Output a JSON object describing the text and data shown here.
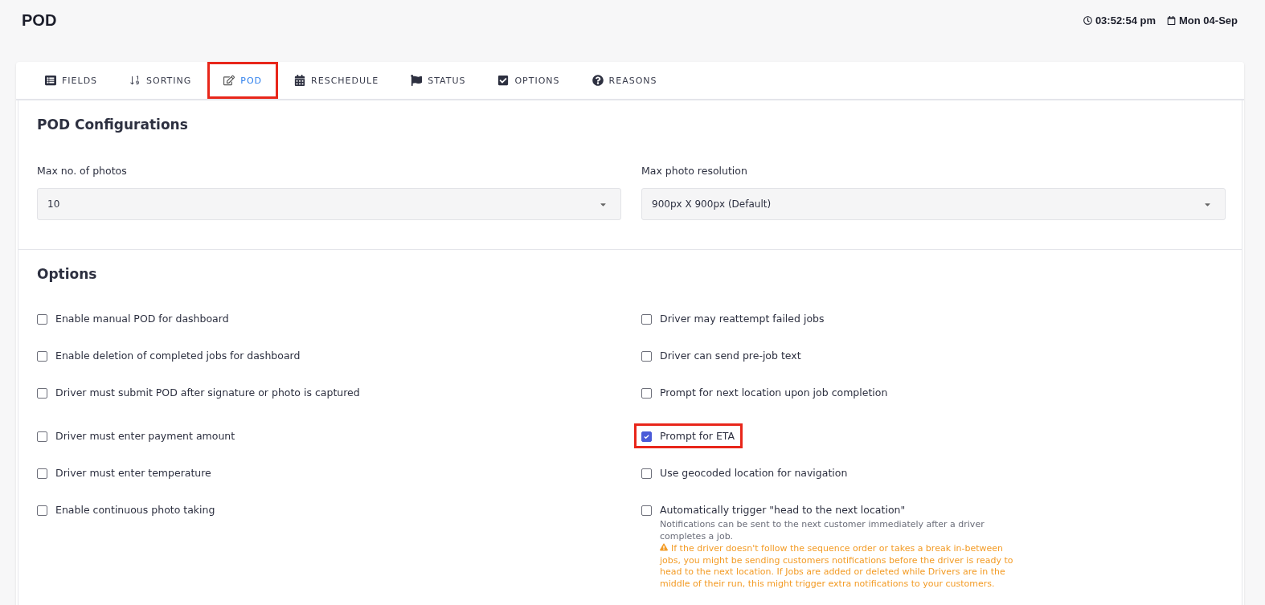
{
  "page": {
    "title": "POD",
    "time": "03:52:54 pm",
    "date": "Mon 04-Sep"
  },
  "tabs": [
    {
      "label": "FIELDS",
      "selected": false,
      "highlighted": false
    },
    {
      "label": "SORTING",
      "selected": false,
      "highlighted": false
    },
    {
      "label": "POD",
      "selected": true,
      "highlighted": true
    },
    {
      "label": "RESCHEDULE",
      "selected": false,
      "highlighted": false
    },
    {
      "label": "STATUS",
      "selected": false,
      "highlighted": false
    },
    {
      "label": "OPTIONS",
      "selected": false,
      "highlighted": false
    },
    {
      "label": "REASONS",
      "selected": false,
      "highlighted": false
    }
  ],
  "pod_configurations": {
    "title": "POD Configurations",
    "fields": [
      {
        "label": "Max no. of photos",
        "value": "10"
      },
      {
        "label": "Max photo resolution",
        "value": "900px X 900px (Default)"
      }
    ]
  },
  "options": {
    "title": "Options",
    "left": [
      {
        "label": "Enable manual POD for dashboard",
        "checked": false,
        "highlighted": false
      },
      {
        "label": "Enable deletion of completed jobs for dashboard",
        "checked": false,
        "highlighted": false
      },
      {
        "label": "Driver must submit POD after signature or photo is captured",
        "checked": false,
        "highlighted": false
      },
      {
        "label": "Driver must enter payment amount",
        "checked": false,
        "highlighted": false
      },
      {
        "label": "Driver must enter temperature",
        "checked": false,
        "highlighted": false
      },
      {
        "label": "Enable continuous photo taking",
        "checked": false,
        "highlighted": false
      }
    ],
    "right": [
      {
        "label": "Driver may reattempt failed jobs",
        "checked": false,
        "highlighted": false
      },
      {
        "label": "Driver can send pre-job text",
        "checked": false,
        "highlighted": false
      },
      {
        "label": "Prompt for next location upon job completion",
        "checked": false,
        "highlighted": false
      },
      {
        "label": "Prompt for ETA",
        "checked": true,
        "highlighted": true
      },
      {
        "label": "Use geocoded location for navigation",
        "checked": false,
        "highlighted": false
      },
      {
        "label": "Automatically trigger \"head to the next location\"",
        "checked": false,
        "highlighted": false,
        "description": "Notifications can be sent to the next customer immediately after a driver completes a job.",
        "warning": "If the driver doesn't follow the sequence order or takes a break in-between jobs, you might be sending customers notifications before the driver is ready to head to the next location. If Jobs are added or deleted while Drivers are in the middle of their run, this might trigger extra notifications to your customers."
      }
    ]
  }
}
